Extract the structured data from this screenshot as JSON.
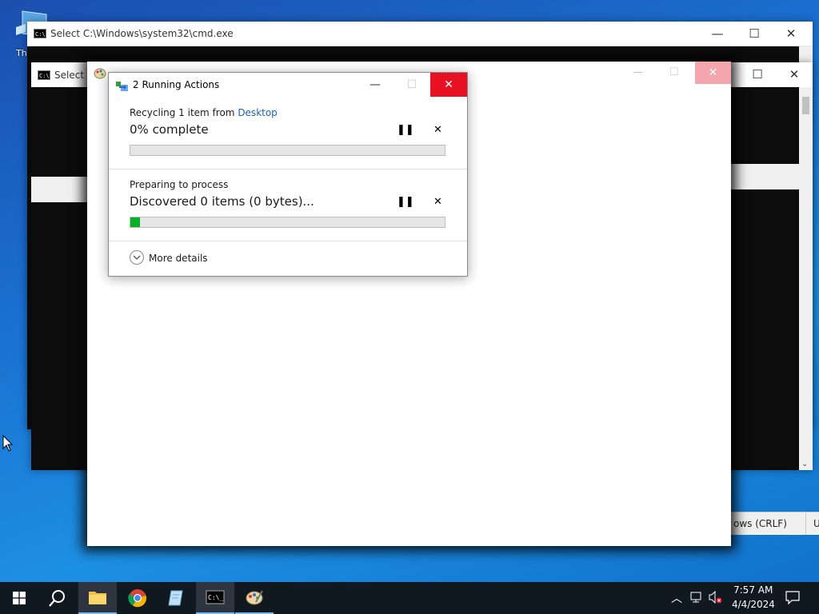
{
  "desktop": {
    "icon_label": "Thi"
  },
  "cmd_back": {
    "title": "Select C:\\Windows\\system32\\cmd.exe"
  },
  "cmd_front": {
    "title": "Select C"
  },
  "paint": {
    "title": "Paint"
  },
  "notepad_status": {
    "line_ending": "Windows (CRLF)",
    "line_ending_visible": "ows (CRLF)",
    "encoding_fragment": "U"
  },
  "dialog": {
    "title": "2 Running Actions",
    "minimize": "—",
    "maximize": "☐",
    "close": "✕",
    "op1": {
      "label_prefix": "Recycling 1 item from ",
      "label_link": "Desktop",
      "status": "0% complete",
      "progress_pct": 0
    },
    "op2": {
      "label": "Preparing to process",
      "status": "Discovered 0 items (0 bytes)...",
      "progress_pct": 3
    },
    "pause_glyph": "❚❚",
    "cancel_glyph": "✕",
    "more_details": "More details"
  },
  "taskbar": {
    "time": "7:57 AM",
    "date": "4/4/2024"
  },
  "colors": {
    "accent": "#0078d7",
    "progress": "#06b025",
    "close_hover": "#e81123"
  }
}
